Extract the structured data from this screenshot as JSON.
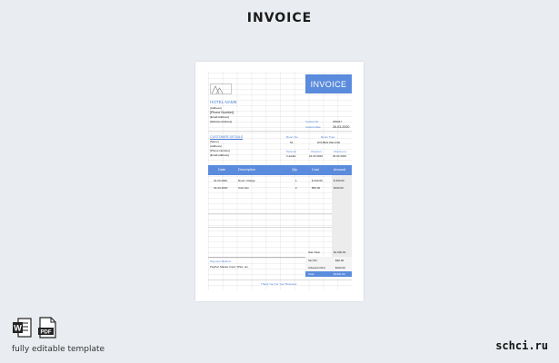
{
  "header": {
    "title": "INVOICE"
  },
  "invoice": {
    "banner": "INVOICE",
    "hotel_name": "HOTEL NAME",
    "hotel_lines": [
      "[Address]",
      "[Phone Number]",
      "[Email Address]",
      "[Website Address]"
    ],
    "invoice_no_label": "Invoice No.",
    "invoice_no": "256347",
    "invoice_date_label": "Invoice Date",
    "invoice_date": "26-03-2020",
    "customer_label": "CUSTOMER DETAILS",
    "customer_lines": [
      "[Name]",
      "[Address]",
      "[Phone Number]",
      "[Email address]"
    ],
    "room_no_label": "Room No.",
    "room_no": "52",
    "room_type_label": "Room Type",
    "room_type": "DOUBLE DELUXE",
    "persons_label": "Persons",
    "persons": "2 adults",
    "checkin_label": "Check-in",
    "checkin": "24.03.2020",
    "checkout_label": "Check-out",
    "checkout": "26.03.2020",
    "columns": [
      "Date",
      "Description",
      "Qty",
      "Cost",
      "Amount"
    ],
    "rows": [
      {
        "date": "24.03.2020",
        "description": "Room Charge",
        "qty": "1",
        "cost": "$ 400.00",
        "amount": "$ 400.00"
      },
      {
        "date": "24-03-2020",
        "description": "Cab Hire",
        "qty": "2",
        "cost": "$50.00",
        "amount": "$100.00"
      }
    ],
    "subtotal_label": "Sub-Total",
    "subtotal": "$1,500.00",
    "tax_label": "Tax 5%",
    "tax": "$30.00",
    "advance_label": "Advance Paid",
    "advance": "$100.00",
    "total_label": "Total",
    "total": "$1432.00",
    "payment_label": "Payment Method",
    "payment_value": "PayPal, Master Card, VISA, etc.",
    "footer_note": "Thank You For Your Business"
  },
  "bottom": {
    "caption": "fully editable template",
    "icon_word_label": "W",
    "icon_pdf_label": "PDF",
    "watermark": "schci.ru"
  },
  "colors": {
    "accent": "#5b8bdc",
    "background": "#e9ecf0"
  }
}
